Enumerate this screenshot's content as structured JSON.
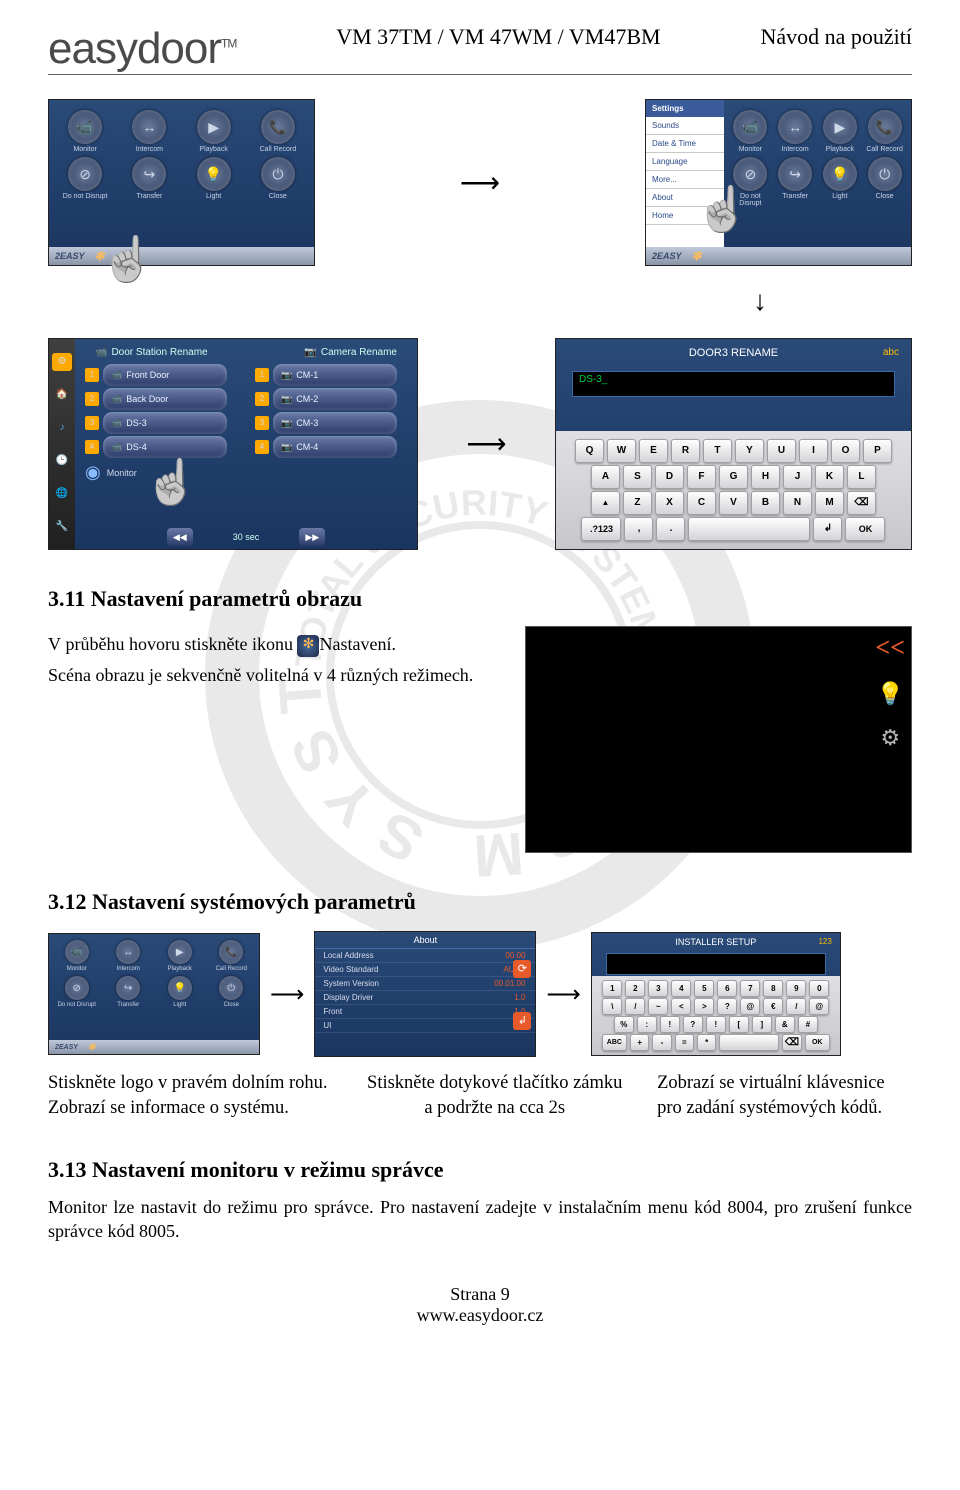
{
  "header": {
    "logo": "easydoor",
    "tm": "TM",
    "model": "VM 37TM / VM 47WM / VM47BM",
    "doctype": "Návod na použití"
  },
  "home": {
    "items": [
      "Monitor",
      "Intercom",
      "Playback",
      "Call Record",
      "Do not Disrupt",
      "Transfer",
      "Light",
      "Close"
    ],
    "brand": "2EASY"
  },
  "settings_menu": {
    "title": "Settings",
    "items": [
      "Sounds",
      "Date & Time",
      "Language",
      "More...",
      "About",
      "Home"
    ]
  },
  "rename": {
    "col1": "Door Station Rename",
    "col2": "Camera Rename",
    "doors": [
      "Front Door",
      "Back Door",
      "DS-3",
      "DS-4"
    ],
    "cams": [
      "CM-1",
      "CM-2",
      "CM-3",
      "CM-4"
    ],
    "monitor": "Monitor",
    "seconds": "30 sec"
  },
  "kb": {
    "title": "DOOR3 RENAME",
    "mode": "abc",
    "value": "DS-3_",
    "row1": [
      "Q",
      "W",
      "E",
      "R",
      "T",
      "Y",
      "U",
      "I",
      "O",
      "P"
    ],
    "row2": [
      "A",
      "S",
      "D",
      "F",
      "G",
      "H",
      "J",
      "K",
      "L"
    ],
    "row3": [
      "Z",
      "X",
      "C",
      "V",
      "B",
      "N",
      "M"
    ],
    "num": ".?123",
    "ok": "OK"
  },
  "sec311": {
    "h": "3.11  Nastavení parametrů obrazu",
    "p1a": "V průběhu hovoru stiskněte ikonu ",
    "p1b": "Nastavení.",
    "p2": "Scéna obrazu je sekvenčně volitelná v 4 různých režimech.",
    "back_label": "<<"
  },
  "sec312": {
    "h": "3.12  Nastavení systémových parametrů",
    "about": {
      "title": "About",
      "rows": [
        [
          "Local Address",
          "00.00"
        ],
        [
          "Video Standard",
          "AUTO"
        ],
        [
          "System Version",
          "00.01.00"
        ],
        [
          "Display Driver",
          "1.0"
        ],
        [
          "Front",
          "1.0"
        ],
        [
          "UI",
          "1.0"
        ]
      ]
    },
    "installer": {
      "title": "INSTALLER SETUP",
      "mode": "123",
      "row1": [
        "1",
        "2",
        "3",
        "4",
        "5",
        "6",
        "7",
        "8",
        "9",
        "0"
      ],
      "row2": [
        "\\",
        "/",
        "~",
        "<",
        ">",
        "?",
        "@",
        "€",
        "/",
        "@"
      ],
      "row3": [
        "%",
        ":",
        "!",
        "?",
        "!",
        "[",
        "]",
        "&",
        "#"
      ],
      "abc": "ABC",
      "ok": "OK"
    },
    "cap1a": "Stiskněte logo v pravém dolním rohu.",
    "cap1b": "Zobrazí se informace o systému.",
    "cap2a": "Stiskněte dotykové tlačítko zámku",
    "cap2b": "a podržte na cca 2s",
    "cap3a": "Zobrazí se virtuální klávesnice",
    "cap3b": "pro zadání systémových kódů."
  },
  "sec313": {
    "h": "3.13  Nastavení monitoru v režimu správce",
    "p": "Monitor lze nastavit do režimu pro správce. Pro nastavení zadejte v instalačním menu kód 8004, pro zrušení funkce správce kód 8005."
  },
  "footer": {
    "page": "Strana 9",
    "url": "www.easydoor.cz"
  },
  "icon_glyphs": [
    "📹",
    "↔",
    "▶",
    "📞",
    "⊘",
    "↪",
    "💡",
    "⏻"
  ]
}
